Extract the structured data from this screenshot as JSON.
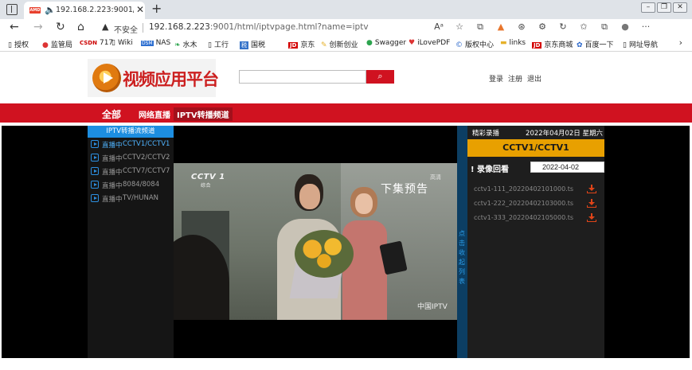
{
  "browser": {
    "tab_title": "192.168.2.223:9001/html/iptv",
    "tab_badge": "AMD",
    "address_security_label": "不安全",
    "address_host": "192.168.2.223",
    "address_path": ":9001/html/iptvpage.html?name=iptv",
    "toolbar_icons": [
      "read-aloud-icon",
      "add-favorite-icon",
      "extension-icon",
      "vlc-icon",
      "extension-icon-2",
      "extension-icon-3",
      "refresh-icon",
      "favorites-icon",
      "collections-icon",
      "profile-icon",
      "more-icon"
    ],
    "bookmarks": [
      {
        "label": "授权",
        "icon": "page-icon"
      },
      {
        "label": "监管局",
        "icon": "flame-icon"
      },
      {
        "label": "717",
        "icon": "csdn-icon",
        "badge": "CSDN"
      },
      {
        "label": "Wiki",
        "icon": "page-icon"
      },
      {
        "label": "NAS",
        "icon": "dsm-icon",
        "badge": "DSM"
      },
      {
        "label": "水木",
        "icon": "leaf-icon"
      },
      {
        "label": "工行",
        "icon": "page-icon"
      },
      {
        "label": "国税",
        "icon": "tax-icon",
        "badge": "税"
      },
      {
        "label": "京东",
        "icon": "jd-icon",
        "badge": "JD"
      },
      {
        "label": "创新创业",
        "icon": "bulb-icon"
      },
      {
        "label": "Swagger",
        "icon": "swagger-icon"
      },
      {
        "label": "iLovePDF",
        "icon": "heart-icon"
      },
      {
        "label": "版权中心",
        "icon": "copyright-icon"
      },
      {
        "label": "links",
        "icon": "folder-icon"
      },
      {
        "label": "京东商城",
        "icon": "jd-icon",
        "badge": "JD"
      },
      {
        "label": "百度一下",
        "icon": "baidu-icon"
      },
      {
        "label": "网址导航",
        "icon": "page-icon"
      }
    ]
  },
  "site": {
    "logo_text": "视频应用平台",
    "search_placeholder": "",
    "user_links": [
      "登录",
      "注册",
      "退出"
    ],
    "nav": {
      "all_label": "全部",
      "items": [
        "网络直播",
        "IPTV转播频道"
      ],
      "active_index": 1
    }
  },
  "player": {
    "channel_header": "IPTV转播流频道",
    "channels": [
      {
        "status": "直播中",
        "name": "CCTV1/CCTV1",
        "active": true
      },
      {
        "status": "直播中",
        "name": "CCTV2/CCTV2",
        "active": false
      },
      {
        "status": "直播中",
        "name": "CCTV7/CCTV7",
        "active": false
      },
      {
        "status": "直播中",
        "name": "8084/8084",
        "active": false
      },
      {
        "status": "直播中",
        "name": "TV/HUNAN",
        "active": false
      }
    ],
    "video": {
      "channel_logo": "CCTV",
      "channel_logo_number": "1",
      "channel_logo_sub": "综合",
      "overlay_text": "下集预告",
      "hd_mark": "高清",
      "watermark": "中国IPTV"
    },
    "collapse_label": "点击收起列表"
  },
  "recordings": {
    "title": "精彩录播",
    "date_header": "2022年04月02日 星期六",
    "current_channel": "CCTV1/CCTV1",
    "review_label": "! 录像回看",
    "date_value": "2022-04-02",
    "files": [
      "cctv1-111_20220402101000.ts",
      "cctv1-222_20220402103000.ts",
      "cctv1-333_20220402105000.ts"
    ]
  },
  "colors": {
    "brand_red": "#d01220",
    "accent_orange": "#e8a000",
    "channel_blue": "#1d8ee0",
    "download_red": "#e04418"
  }
}
